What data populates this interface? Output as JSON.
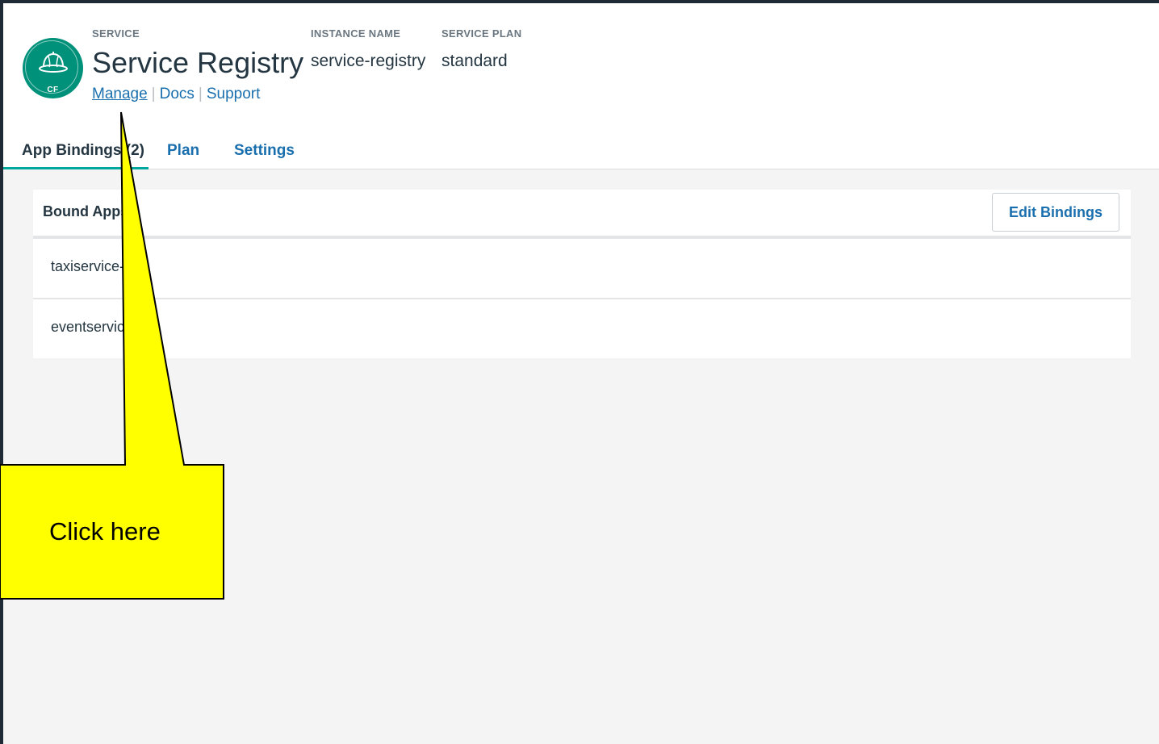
{
  "header": {
    "labels": {
      "service": "SERVICE",
      "instance_name": "INSTANCE NAME",
      "service_plan": "SERVICE PLAN"
    },
    "service_title": "Service Registry",
    "instance_name": "service-registry",
    "service_plan": "standard",
    "logo_text": "CF",
    "links": {
      "manage": "Manage",
      "docs": "Docs",
      "support": "Support",
      "separator": "|"
    }
  },
  "tabs": [
    {
      "label": "App Bindings (2)",
      "active": true
    },
    {
      "label": "Plan",
      "active": false
    },
    {
      "label": "Settings",
      "active": false
    }
  ],
  "bound_apps": {
    "title": "Bound Apps",
    "edit_button": "Edit Bindings",
    "rows": [
      "taxiservice-",
      "eventservic"
    ]
  },
  "callout": {
    "text": "Click here",
    "color": "#ffff00"
  },
  "colors": {
    "brand": "#00917a",
    "link": "#1a6fae",
    "tab_underline": "#00a79d",
    "frame": "#1e2b36"
  },
  "icons": {
    "logo": "helmet-icon"
  }
}
